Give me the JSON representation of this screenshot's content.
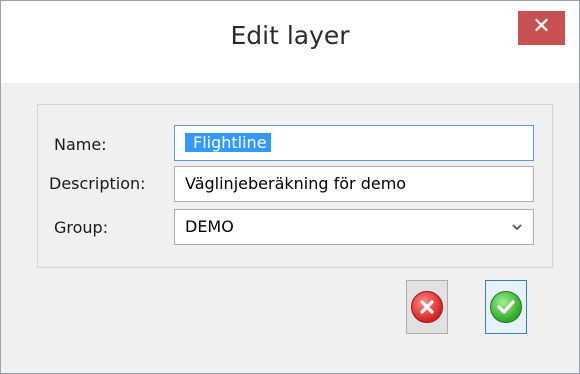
{
  "window": {
    "title": "Edit layer",
    "close_glyph": "✕"
  },
  "form": {
    "name_label": "Name:",
    "name_value": "Flightline",
    "description_label": "Description:",
    "description_value": "Väglinjeberäkning för demo",
    "group_label": "Group:",
    "group_value": "DEMO"
  },
  "buttons": {
    "cancel_icon": "red-x-circle-icon",
    "ok_icon": "green-check-circle-icon"
  },
  "colors": {
    "close_button": "#c75050",
    "selection": "#3399ff",
    "focus_border": "#5b9bd5",
    "cancel_red": "#d42222",
    "ok_green": "#2fa825"
  }
}
